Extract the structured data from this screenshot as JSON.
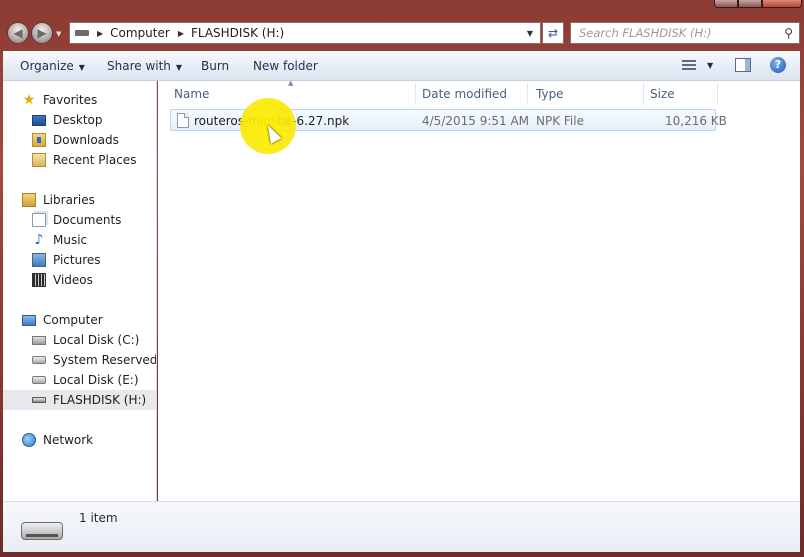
{
  "window": {
    "title_buttons": [
      "minimize",
      "maximize",
      "close"
    ]
  },
  "address": {
    "crumbs": [
      "Computer",
      "FLASHDISK (H:)"
    ],
    "search_placeholder": "Search FLASHDISK (H:)"
  },
  "toolbar": {
    "organize": "Organize",
    "share_with": "Share with",
    "burn": "Burn",
    "new_folder": "New folder"
  },
  "sidebar": {
    "favorites": {
      "label": "Favorites",
      "items": [
        {
          "label": "Desktop",
          "icon": "desktop-icon"
        },
        {
          "label": "Downloads",
          "icon": "downloads-icon"
        },
        {
          "label": "Recent Places",
          "icon": "recent-places-icon"
        }
      ]
    },
    "libraries": {
      "label": "Libraries",
      "items": [
        {
          "label": "Documents",
          "icon": "documents-icon"
        },
        {
          "label": "Music",
          "icon": "music-icon"
        },
        {
          "label": "Pictures",
          "icon": "pictures-icon"
        },
        {
          "label": "Videos",
          "icon": "videos-icon"
        }
      ]
    },
    "computer": {
      "label": "Computer",
      "items": [
        {
          "label": "Local Disk (C:)",
          "icon": "local-disk-icon"
        },
        {
          "label": "System Reserved (D:)",
          "icon": "drive-icon"
        },
        {
          "label": "Local Disk (E:)",
          "icon": "drive-icon"
        },
        {
          "label": "FLASHDISK (H:)",
          "icon": "flash-drive-icon",
          "selected": true
        }
      ]
    },
    "network": {
      "label": "Network"
    }
  },
  "columns": {
    "name": "Name",
    "date_modified": "Date modified",
    "type": "Type",
    "size": "Size"
  },
  "files": [
    {
      "name": "routeros-mipsbe-6.27.npk",
      "date_modified": "4/5/2015 9:51 AM",
      "type": "NPK File",
      "size": "10,216 KB"
    }
  ],
  "details": {
    "item_count": "1 item"
  },
  "colors": {
    "frame": "#8b3b33",
    "toolbar": "#e9eef6",
    "selection": "#e5f0fb",
    "highlight": "#fff000"
  }
}
